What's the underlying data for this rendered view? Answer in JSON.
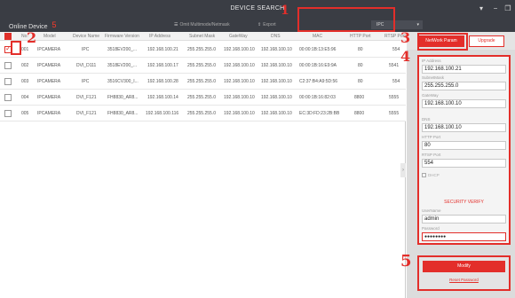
{
  "window": {
    "title": "DEVICE SEARCH",
    "controls": {
      "minimize": "−",
      "restore": "❐"
    },
    "dropdown_marker": "▾"
  },
  "toolbar": {
    "online_label": "Online Device",
    "online_count": "5",
    "modify_netmask_label": "Omit Multimode/Netmask",
    "export_label": "Export",
    "filter_value": "IPC",
    "filter_icon": "chevron-down-icon"
  },
  "table": {
    "columns": [
      "No.",
      "Model",
      "Device Name",
      "Firmware Version",
      "IP Address",
      "Subnet Mask",
      "GateWay",
      "DNS",
      "MAC",
      "HTTP Port",
      "RTSP Port"
    ],
    "rows": [
      {
        "no": "001",
        "model": "IPCAMERA",
        "name": "IPC",
        "firmware": "3518EV200_...",
        "ip": "192.168.100.21",
        "mask": "255.255.255.0",
        "gateway": "192.168.100.10",
        "dns": "192.168.100.10",
        "mac": "00:00:1B:13:E5:96",
        "http": "80",
        "rtsp": "554",
        "checked": true
      },
      {
        "no": "002",
        "model": "IPCAMERA",
        "name": "DVI_D111",
        "firmware": "3518EV200_...",
        "ip": "192.168.100.17",
        "mask": "255.255.255.0",
        "gateway": "192.168.100.10",
        "dns": "192.168.100.10",
        "mac": "00:00:1B:16:E9:9A",
        "http": "80",
        "rtsp": "5541",
        "checked": false
      },
      {
        "no": "003",
        "model": "IPCAMERA",
        "name": "IPC",
        "firmware": "3516CV300_I...",
        "ip": "192.168.100.28",
        "mask": "255.255.255.0",
        "gateway": "192.168.100.10",
        "dns": "192.168.100.10",
        "mac": "C2:37:B4:A9:5D:56",
        "http": "80",
        "rtsp": "554",
        "checked": false
      },
      {
        "no": "004",
        "model": "IPCAMERA",
        "name": "DVI_F121",
        "firmware": "FH8830_AR8...",
        "ip": "192.168.100.14",
        "mask": "255.255.255.0",
        "gateway": "192.168.100.10",
        "dns": "192.168.100.10",
        "mac": "00:00:1B:16:82:03",
        "http": "8800",
        "rtsp": "5555",
        "checked": false
      },
      {
        "no": "005",
        "model": "IPCAMERA",
        "name": "DVI_F121",
        "firmware": "FH8830_AR8...",
        "ip": "192.168.100.116",
        "mask": "255.255.255.0",
        "gateway": "192.168.100.10",
        "dns": "192.168.100.10",
        "mac": "EC:3D:FD:23:2B:BB",
        "http": "8800",
        "rtsp": "5555",
        "checked": false
      }
    ],
    "collapse_arrow": "›"
  },
  "panel": {
    "tab_network": "NetWork Param",
    "tab_upgrade": "Upgrade",
    "ip_label": "IP Address",
    "ip_value": "192.168.100.21",
    "mask_label": "SubnetMask",
    "mask_value": "255.255.255.0",
    "gateway_label": "GateWay",
    "gateway_value": "192.168.100.10",
    "dns_label": "DNS",
    "dns_value": "192.168.100.10",
    "http_label": "HTTP Port",
    "http_value": "80",
    "rtsp_label": "RTSP Port",
    "rtsp_value": "554",
    "dhcp_label": "DHCP",
    "security_title": "SECURITY VERIFY",
    "username_label": "UserName",
    "username_value": "admin",
    "password_label": "Password",
    "password_value": "●●●●●●●●",
    "modify_label": "Modify",
    "reset_label": "Reset Password"
  },
  "markers": {
    "m1": "1",
    "m2": "2",
    "m3": "3",
    "m4": "4",
    "m5": "5"
  },
  "colors": {
    "accent": "#e32e2a",
    "titlebar": "#3a3d44",
    "panel": "#dcdcdc"
  }
}
